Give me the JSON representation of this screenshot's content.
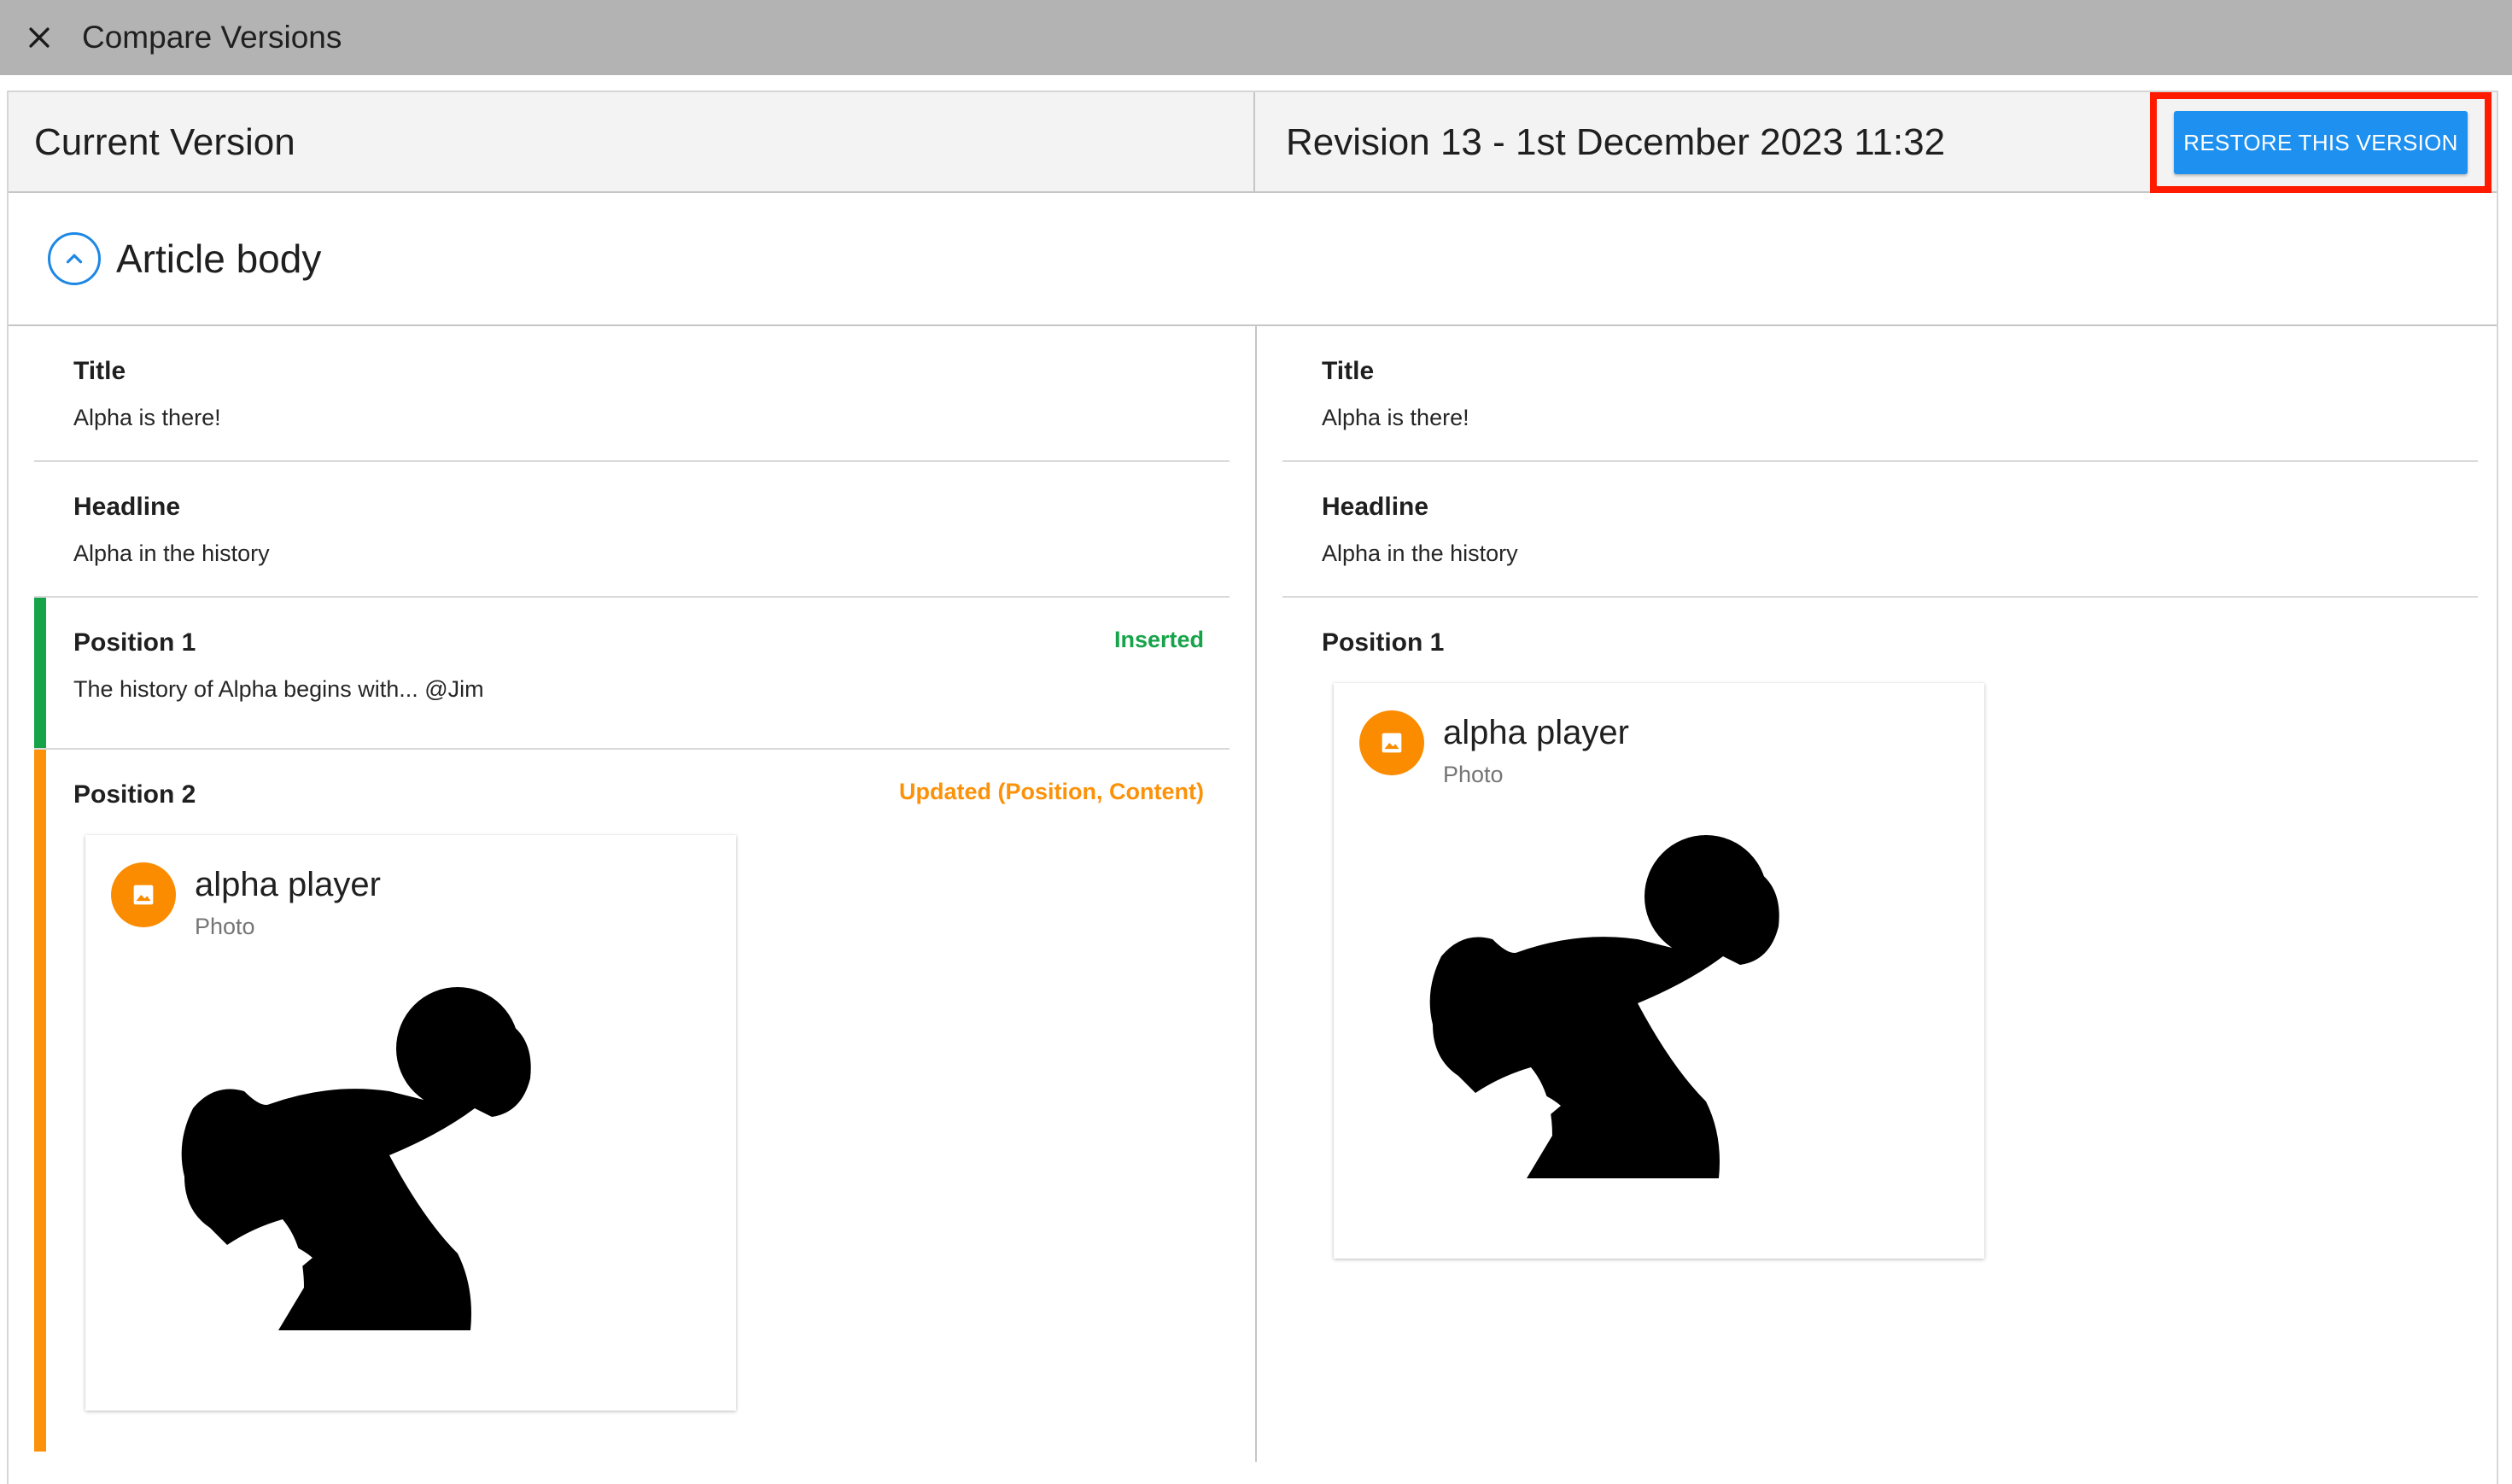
{
  "window": {
    "title": "Compare Versions"
  },
  "header": {
    "left_title": "Current Version",
    "right_title": "Revision 13 - 1st December 2023 11:32",
    "restore_label": "RESTORE THIS VERSION"
  },
  "section": {
    "title": "Article body"
  },
  "left": {
    "title_label": "Title",
    "title_value": "Alpha is there!",
    "headline_label": "Headline",
    "headline_value": "Alpha in the history",
    "pos1_label": "Position 1",
    "pos1_value": "The history of Alpha begins with... @Jim",
    "pos1_status": "Inserted",
    "pos2_label": "Position 2",
    "pos2_status": "Updated (Position, Content)",
    "card": {
      "title": "alpha player",
      "subtitle": "Photo"
    }
  },
  "right": {
    "title_label": "Title",
    "title_value": "Alpha is there!",
    "headline_label": "Headline",
    "headline_value": "Alpha in the history",
    "pos1_label": "Position 1",
    "card": {
      "title": "alpha player",
      "subtitle": "Photo"
    }
  },
  "colors": {
    "inserted": "#17a34a",
    "updated": "#fb9209",
    "accent": "#1e90f0",
    "highlight": "#ff1a00"
  },
  "icons": {
    "close": "close-icon",
    "collapse": "chevron-up-icon",
    "photo": "image-icon"
  }
}
